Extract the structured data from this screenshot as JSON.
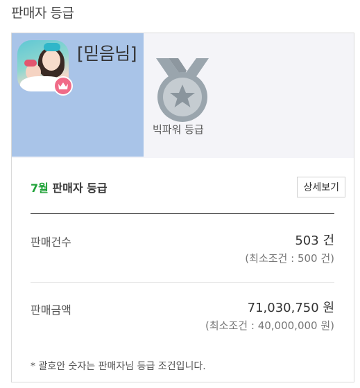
{
  "page": {
    "title": "판매자 등급"
  },
  "hero": {
    "seller_name": "[믿음님]",
    "grade_name": "빅파워 등급"
  },
  "monthly": {
    "month": "7월",
    "title": " 판매자 등급",
    "detail_button": "상세보기"
  },
  "stats": {
    "sales_count": {
      "label": "판매건수",
      "value": "503",
      "unit": "건",
      "minimum": "(최소조건 : 500 건)"
    },
    "sales_amount": {
      "label": "판매금액",
      "value": "71,030,750",
      "unit": "원",
      "minimum": "(최소조건 : 40,000,000 원)"
    }
  },
  "footnote": "* 괄호안 숫자는 판매자님 등급 조건입니다.",
  "icons": {
    "medal": "silver-star-medal-icon",
    "crown": "crown-icon"
  },
  "colors": {
    "profile_bg": "#a9c4e8",
    "month_accent": "#21a33a",
    "medal_silver": "#9aa5ad",
    "crown_badge": "#f06b88"
  }
}
